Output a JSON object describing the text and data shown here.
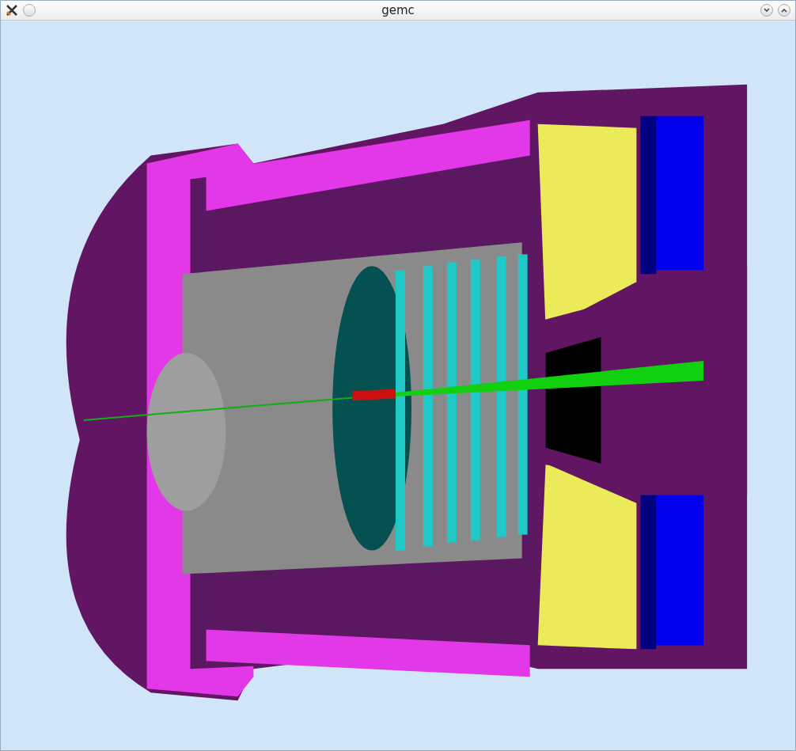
{
  "window": {
    "title": "gemc"
  }
}
